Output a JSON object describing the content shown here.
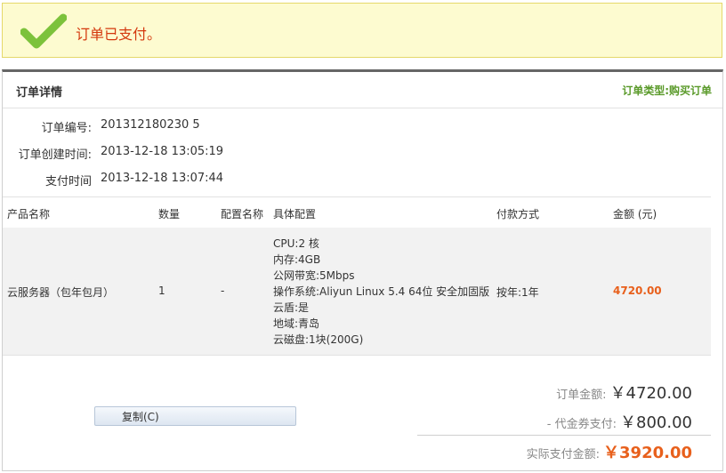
{
  "banner": {
    "message": "订单已支付。"
  },
  "panel": {
    "title": "订单详情",
    "order_type": "订单类型:购买订单"
  },
  "info": [
    {
      "label": "订单编号:",
      "value": "201312180230          5"
    },
    {
      "label": "订单创建时间:",
      "value": "2013-12-18 13:05:19"
    },
    {
      "label": "支付时间",
      "value": "2013-12-18 13:07:44"
    }
  ],
  "table": {
    "headers": [
      "产品名称",
      "数量",
      "配置名称",
      "具体配置",
      "付款方式",
      "金额 (元)"
    ],
    "row": {
      "product": "云服务器（包年包月）",
      "quantity": "1",
      "config_name": "-",
      "specs": [
        "CPU:2 核",
        "内存:4GB",
        "公网带宽:5Mbps",
        "操作系统:Aliyun Linux 5.4 64位 安全加固版",
        "云盾:是",
        "地域:青岛",
        "云磁盘:1块(200G)"
      ],
      "payment": "按年:1年",
      "amount": "4720.00"
    }
  },
  "copy_button": "复制(C)",
  "summary": {
    "order_amount_label": "订单金额:",
    "order_amount": "￥4720.00",
    "voucher_label": "- 代金券支付:",
    "voucher_amount": "￥800.00",
    "paid_label": "实际支付金额:",
    "paid_amount": "￥3920.00"
  },
  "colors": {
    "accent_orange": "#e8601c",
    "success_green": "#7cc23b",
    "banner_bg": "#fdfbd0"
  }
}
